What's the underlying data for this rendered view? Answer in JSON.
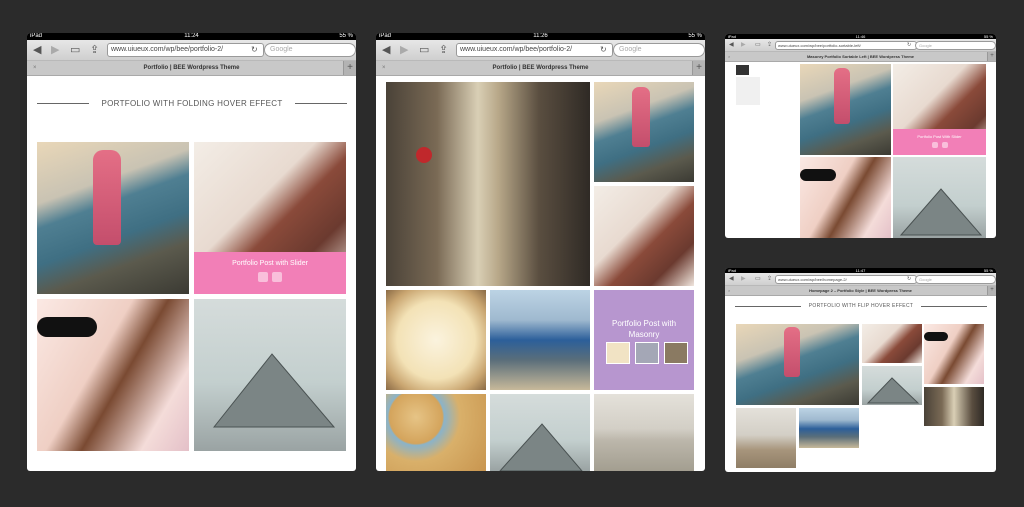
{
  "colors": {
    "page_bg": "#2b2b2b",
    "overlay_pink": "#f27fb7",
    "overlay_purple": "#b796cf"
  },
  "screen1": {
    "status": {
      "left": "iPad",
      "time": "11:24",
      "battery": "55 %"
    },
    "url": "www.uiueux.com/wp/bee/portfolio-2/",
    "search_placeholder": "Google",
    "tab_title": "Portfolio | BEE Wordpress Theme",
    "heading": "PORTFOLIO WITH FOLDING HOVER EFFECT",
    "overlay_title": "Portfolio Post with Slider"
  },
  "screen2": {
    "status": {
      "left": "iPad",
      "time": "11:26",
      "battery": "55 %"
    },
    "url": "www.uiueux.com/wp/bee/portfolio-2/",
    "search_placeholder": "Google",
    "tab_title": "Portfolio | BEE Wordpress Theme",
    "overlay_title": "Portfolio Post with Masonry"
  },
  "screen3": {
    "status": {
      "left": "iPad",
      "time": "11:46",
      "battery": "55 %"
    },
    "url": "www.uiueux.com/wp/bee/portfolio-sortable-left/",
    "search_placeholder": "Google",
    "tab_title": "Masonry Portfolio Sortable Left | BEE Wordpress Theme",
    "overlay_title": "Portfolio Post With Slider"
  },
  "screen4": {
    "status": {
      "left": "iPad",
      "time": "11:47",
      "battery": "55 %"
    },
    "url": "www.uiueux.com/wp/bee/homepage-2/",
    "search_placeholder": "Google",
    "tab_title": "Homepage 2 – Portfolio Style | BEE Wordpress Theme",
    "heading": "PORTFOLIO WITH FLIP HOVER EFFECT"
  },
  "icons": {
    "back": "back-arrow-icon",
    "forward": "forward-arrow-icon",
    "bookmarks": "bookmarks-icon",
    "share": "share-icon",
    "reload": "reload-icon",
    "close": "close-icon",
    "add": "plus-icon"
  }
}
